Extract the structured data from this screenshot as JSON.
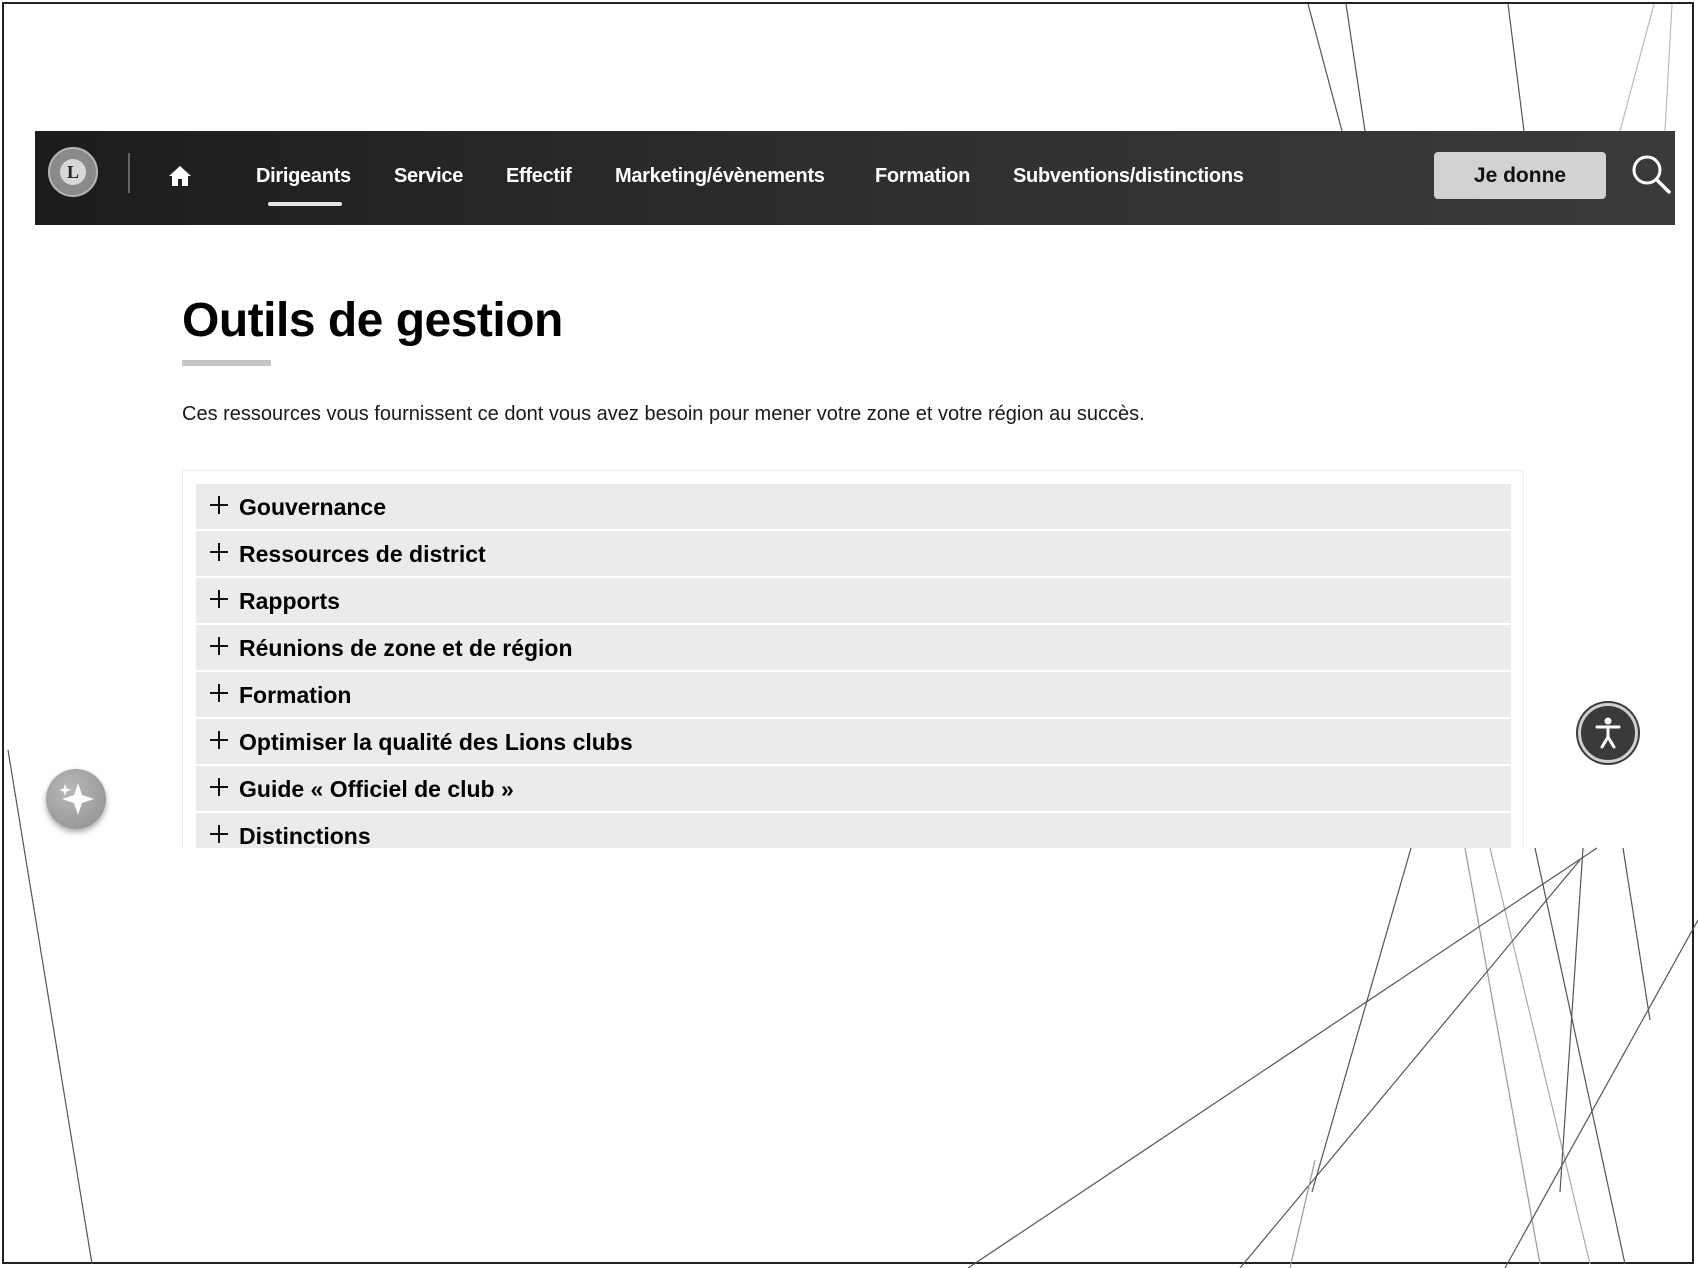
{
  "nav": {
    "logo_text": "L",
    "links": [
      "Dirigeants",
      "Service",
      "Effectif",
      "Marketing/évènements",
      "Formation",
      "Subventions/distinctions"
    ],
    "active": "Dirigeants",
    "donate_label": "Je donne"
  },
  "main": {
    "title": "Outils de gestion",
    "intro": "Ces ressources vous fournissent ce dont vous avez besoin pour mener votre zone et votre région au succès.",
    "accordion": [
      "Gouvernance",
      "Ressources de district",
      "Rapports",
      "Réunions de zone et de région",
      "Formation",
      "Optimiser la qualité des Lions clubs",
      "Guide « Officiel de club »",
      "Distinctions"
    ]
  },
  "icons": {
    "home": "home-icon",
    "search": "search-icon",
    "expand": "plus-icon",
    "sparkle": "sparkle-icon",
    "accessibility": "accessibility-icon"
  }
}
